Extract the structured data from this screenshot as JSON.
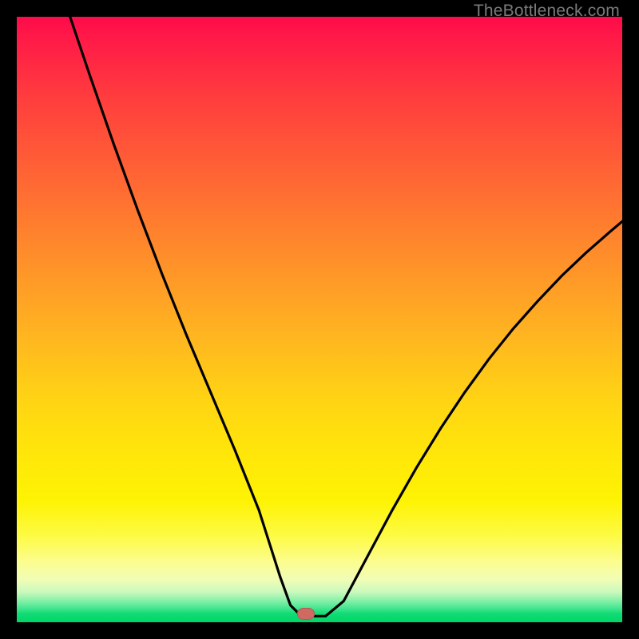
{
  "watermark": "TheBottleneck.com",
  "marker": {
    "x_frac": 0.478,
    "y_frac": 0.99
  },
  "chart_data": {
    "type": "line",
    "title": "",
    "xlabel": "",
    "ylabel": "",
    "xlim": [
      0,
      1
    ],
    "ylim": [
      0,
      1
    ],
    "grid": false,
    "legend": false,
    "series": [
      {
        "name": "curve",
        "color": "#000000",
        "x": [
          0.088,
          0.12,
          0.16,
          0.2,
          0.24,
          0.28,
          0.32,
          0.36,
          0.4,
          0.435,
          0.452,
          0.47,
          0.51,
          0.54,
          0.58,
          0.62,
          0.66,
          0.7,
          0.74,
          0.78,
          0.82,
          0.86,
          0.9,
          0.94,
          0.98,
          1.0
        ],
        "y": [
          1.0,
          0.905,
          0.79,
          0.68,
          0.575,
          0.475,
          0.38,
          0.285,
          0.185,
          0.075,
          0.028,
          0.01,
          0.01,
          0.035,
          0.11,
          0.185,
          0.255,
          0.32,
          0.38,
          0.435,
          0.485,
          0.53,
          0.572,
          0.61,
          0.645,
          0.662
        ]
      }
    ],
    "marker": {
      "x": 0.478,
      "y": 0.01,
      "color": "#cf6a63"
    }
  }
}
